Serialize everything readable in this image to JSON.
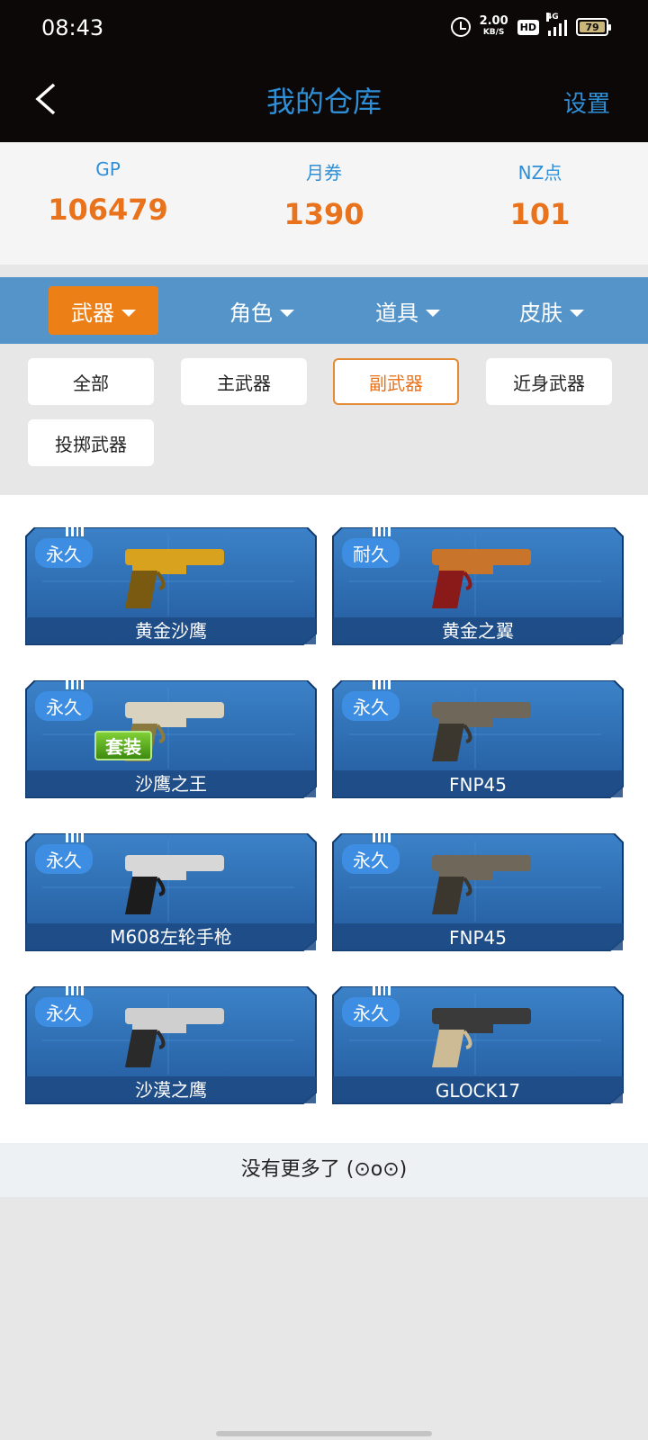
{
  "status": {
    "time": "08:43",
    "speed": "2.00",
    "speed_unit": "KB/S",
    "hd": "HD",
    "network": "4G",
    "battery": "79"
  },
  "header": {
    "title": "我的仓库",
    "settings": "设置"
  },
  "currency": [
    {
      "label": "GP",
      "value": "106479"
    },
    {
      "label": "月券",
      "value": "1390"
    },
    {
      "label": "NZ点",
      "value": "101"
    }
  ],
  "categories": [
    "武器",
    "角色",
    "道具",
    "皮肤"
  ],
  "filters": [
    "全部",
    "主武器",
    "副武器",
    "近身武器",
    "投掷武器"
  ],
  "weapons": [
    {
      "tag": "永久",
      "name": "黄金沙鹰",
      "badge": ""
    },
    {
      "tag": "耐久",
      "name": "黄金之翼",
      "badge": ""
    },
    {
      "tag": "永久",
      "name": "沙鹰之王",
      "badge": "套装"
    },
    {
      "tag": "永久",
      "name": "FNP45",
      "badge": ""
    },
    {
      "tag": "永久",
      "name": "M608左轮手枪",
      "badge": ""
    },
    {
      "tag": "永久",
      "name": "FNP45",
      "badge": ""
    },
    {
      "tag": "永久",
      "name": "沙漠之鹰",
      "badge": ""
    },
    {
      "tag": "永久",
      "name": "GLOCK17",
      "badge": ""
    }
  ],
  "footer": {
    "no_more": "没有更多了 (⊙o⊙)"
  },
  "colors": {
    "accent": "#ec7f16",
    "title_blue": "#2f8fd6",
    "category_bar": "#5594c9",
    "card_blue": "#2f6fb5"
  }
}
